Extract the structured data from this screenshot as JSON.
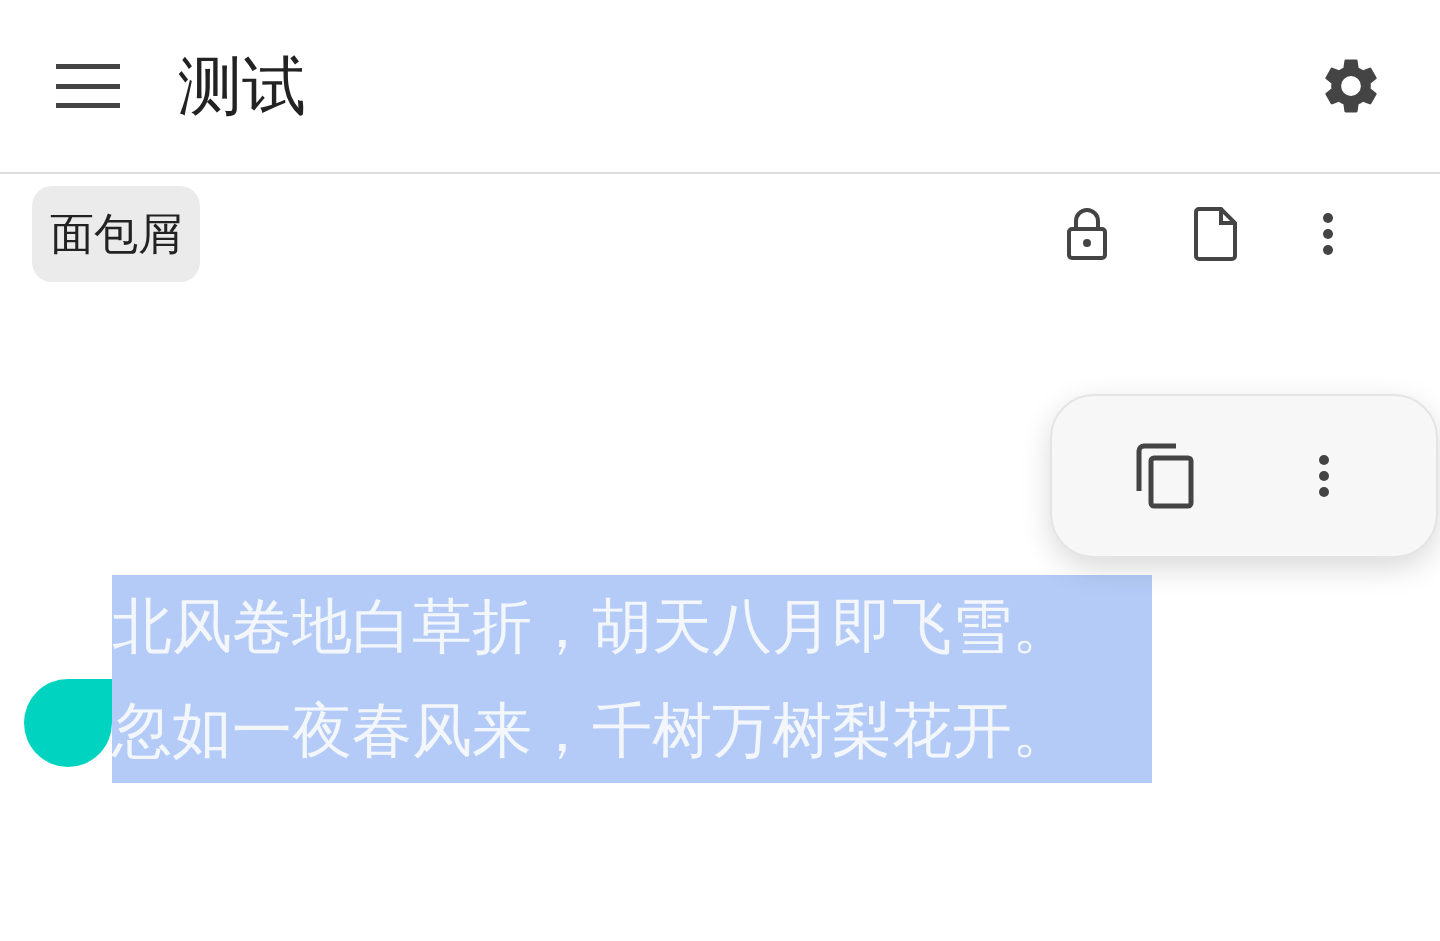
{
  "app_bar": {
    "title": "测试"
  },
  "breadcrumb": {
    "label": "面包屑"
  },
  "selection_menu": {
    "visible": true
  },
  "text": {
    "selected": true,
    "lines": [
      "北风卷地白草折，胡天八月即飞雪。",
      "忽如一夜春风来，千树万树梨花开。"
    ]
  }
}
